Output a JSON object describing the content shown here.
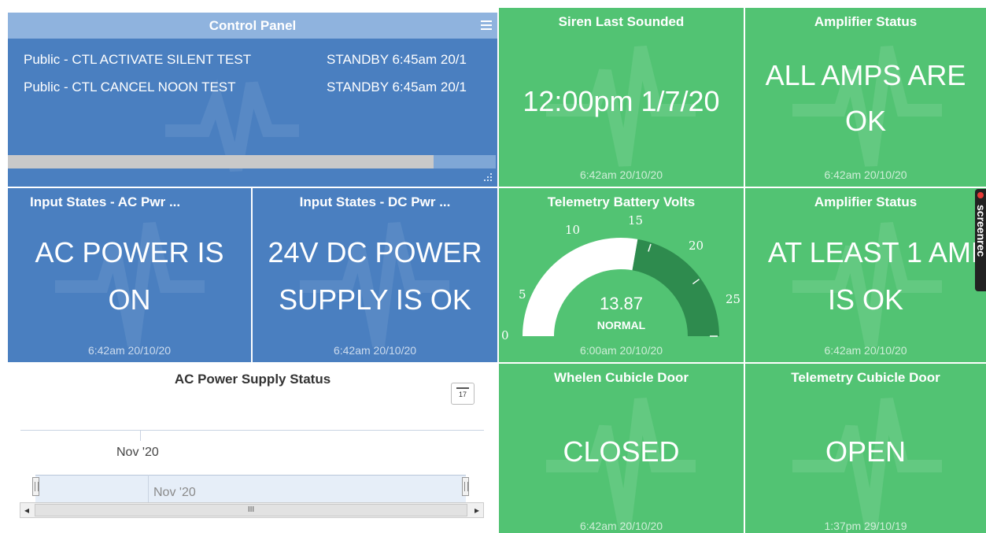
{
  "control_panel": {
    "title": "Control Panel",
    "rows": [
      {
        "name": "Public - CTL ACTIVATE SILENT TEST",
        "state": "STANDBY 6:45am 20/1"
      },
      {
        "name": "Public - CTL CANCEL NOON TEST",
        "state": "STANDBY 6:45am 20/1"
      }
    ],
    "scroll_fraction": 0.87,
    "colors": {
      "body": "#4a7fc0",
      "header": "#8fb3de"
    }
  },
  "tiles": {
    "siren_last_sounded": {
      "title": "Siren Last Sounded",
      "value": "12:00pm 1/7/20",
      "timestamp": "6:42am 20/10/20"
    },
    "amplifier_status_1": {
      "title": "Amplifier Status",
      "value_line1": "ALL AMPS ARE",
      "value_line2": "OK",
      "timestamp": "6:42am 20/10/20"
    },
    "input_ac": {
      "title": "Input States - AC Pwr ...",
      "value_line1": "AC POWER IS",
      "value_line2": "ON",
      "timestamp": "6:42am 20/10/20"
    },
    "input_dc": {
      "title": "Input States - DC Pwr ...",
      "value_line1": "24V DC POWER",
      "value_line2": "SUPPLY IS OK",
      "timestamp": "6:42am 20/10/20"
    },
    "telemetry_battery": {
      "title": "Telemetry Battery Volts",
      "value": "13.87",
      "status": "NORMAL",
      "timestamp": "6:00am 20/10/20",
      "gauge": {
        "min": 0,
        "max": 25,
        "value": 13.87,
        "ticks": [
          "0",
          "5",
          "10",
          "15",
          "20",
          "25"
        ]
      }
    },
    "amplifier_status_2": {
      "title": "Amplifier Status",
      "value_line1": "AT LEAST 1 AMP",
      "value_line2": "IS OK",
      "timestamp": "6:42am 20/10/20"
    },
    "whelen_door": {
      "title": "Whelen Cubicle Door",
      "value": "CLOSED",
      "timestamp": "6:42am 20/10/20"
    },
    "telemetry_door": {
      "title": "Telemetry Cubicle Door",
      "value": "OPEN",
      "timestamp": "1:37pm 29/10/19"
    }
  },
  "chart_panel": {
    "title": "AC Power Supply Status",
    "calendar_icon": "calendar-icon",
    "calendar_day": "17",
    "axis_label": "Nov '20",
    "navigator_label": "Nov '20",
    "scroll_thumb_label": "III"
  },
  "side_tab": {
    "label": "screenrec"
  },
  "colors": {
    "blue_tile": "#4a7fc0",
    "green_tile": "#52c373",
    "gauge_dark": "#2e8b4e",
    "gauge_light": "#ffffff"
  }
}
